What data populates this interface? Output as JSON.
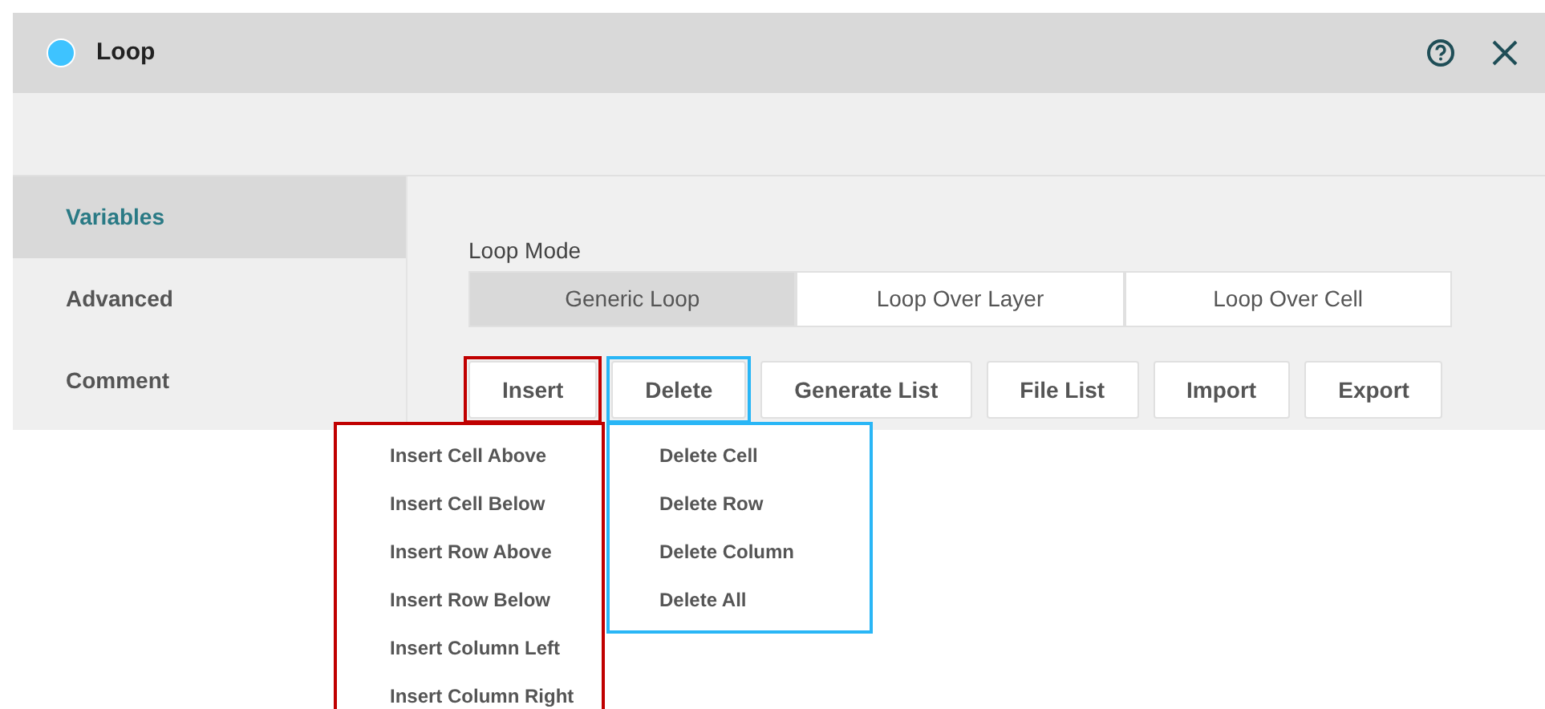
{
  "window": {
    "title": "Loop"
  },
  "sidebar": {
    "items": [
      {
        "label": "Variables",
        "selected": true
      },
      {
        "label": "Advanced",
        "selected": false
      },
      {
        "label": "Comment",
        "selected": false
      }
    ]
  },
  "loop_mode": {
    "label": "Loop Mode",
    "options": [
      {
        "label": "Generic Loop",
        "selected": true
      },
      {
        "label": "Loop Over Layer",
        "selected": false
      },
      {
        "label": "Loop Over Cell",
        "selected": false
      }
    ]
  },
  "buttons": [
    {
      "label": "Insert",
      "color": "#c00000"
    },
    {
      "label": "Delete",
      "color": "#29b6f6"
    },
    {
      "label": "Generate List"
    },
    {
      "label": "File List"
    },
    {
      "label": "Import"
    },
    {
      "label": "Export"
    }
  ],
  "menus": [
    {
      "color": "#c00000",
      "items": [
        "Insert Cell Above",
        "Insert Cell Below",
        "Insert Row Above",
        "Insert Row Below",
        "Insert Column Left",
        "Insert Column Right"
      ]
    },
    {
      "color": "#29b6f6",
      "items": [
        "Delete Cell",
        "Delete Row",
        "Delete Column",
        "Delete All"
      ]
    }
  ]
}
